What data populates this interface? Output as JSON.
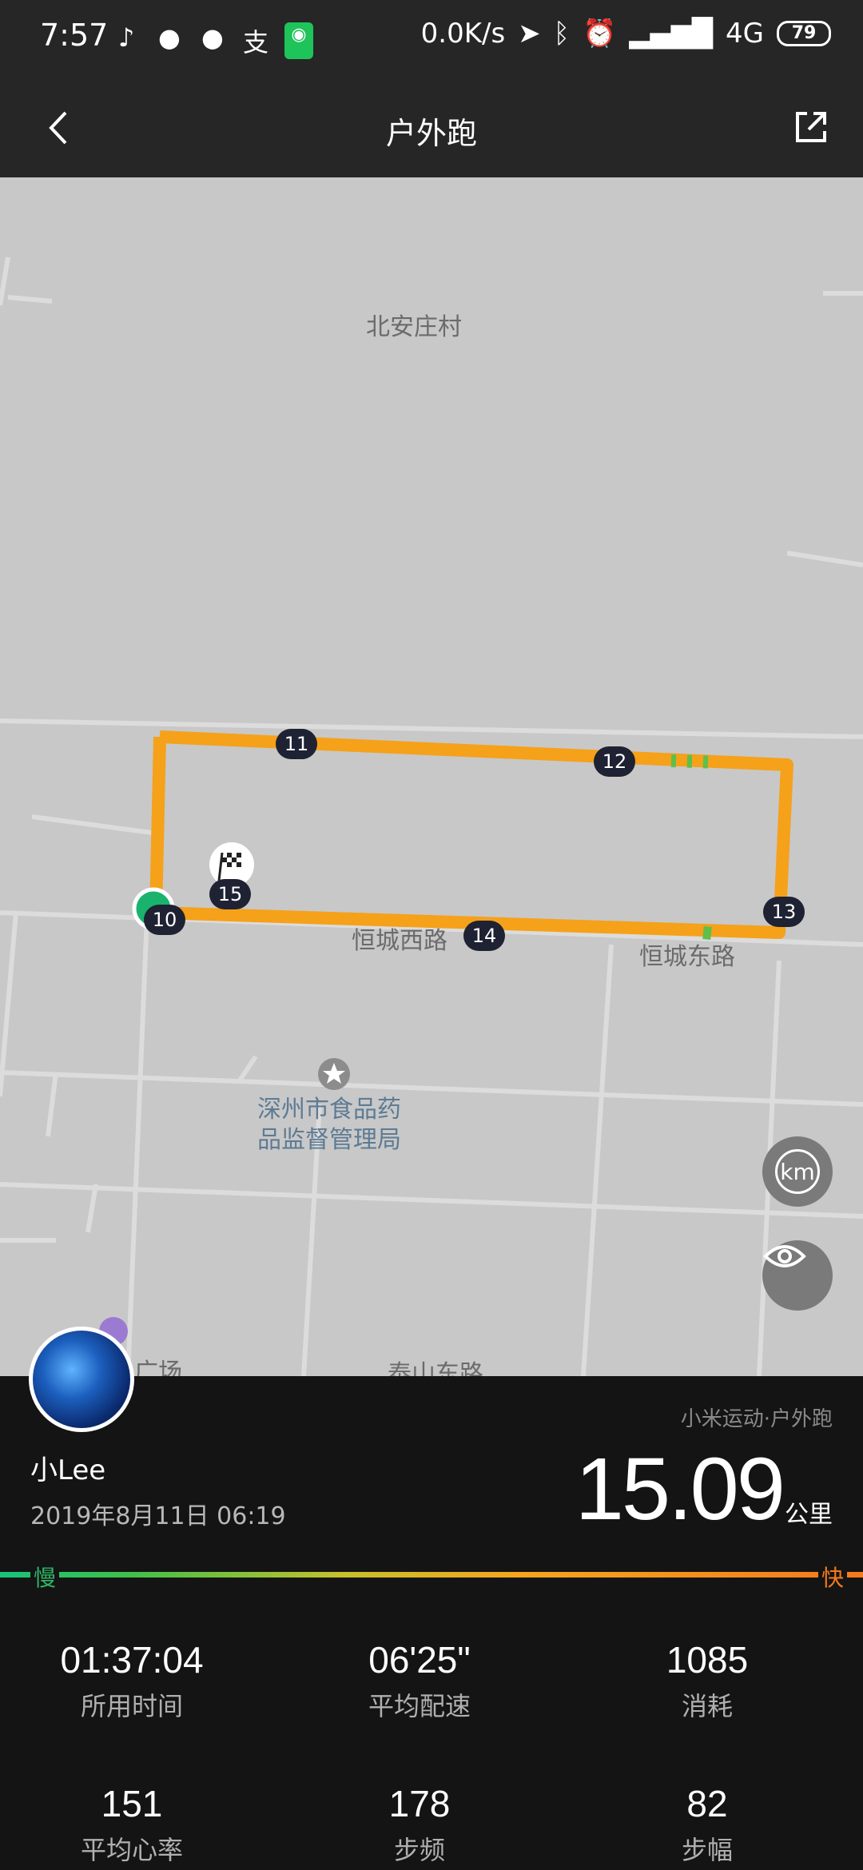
{
  "status_bar": {
    "time": "7:57",
    "net_speed": "0.0K/s",
    "network": "4G",
    "battery": "79"
  },
  "header": {
    "title": "户外跑"
  },
  "map": {
    "labels": {
      "village": "北安庄村",
      "road_west": "恒城西路",
      "road_east": "恒城东路",
      "poi_line1": "深州市食品药",
      "poi_line2": "品监督管理局",
      "plaza": "广场",
      "road_south": "泰山东路"
    },
    "km_markers": [
      "10",
      "11",
      "12",
      "13",
      "14",
      "15"
    ],
    "km_button": "km"
  },
  "summary": {
    "source": "小米运动·户外跑",
    "user": "小Lee",
    "datetime": "2019年8月11日 06:19",
    "distance": "15.09",
    "distance_unit": "公里",
    "pace_slow": "慢",
    "pace_fast": "快"
  },
  "stats": [
    {
      "value": "01:37:04",
      "label": "所用时间"
    },
    {
      "value": "06'25\"",
      "label": "平均配速"
    },
    {
      "value": "1085",
      "label": "消耗"
    },
    {
      "value": "151",
      "label": "平均心率"
    },
    {
      "value": "178",
      "label": "步频"
    },
    {
      "value": "82",
      "label": "步幅"
    }
  ]
}
